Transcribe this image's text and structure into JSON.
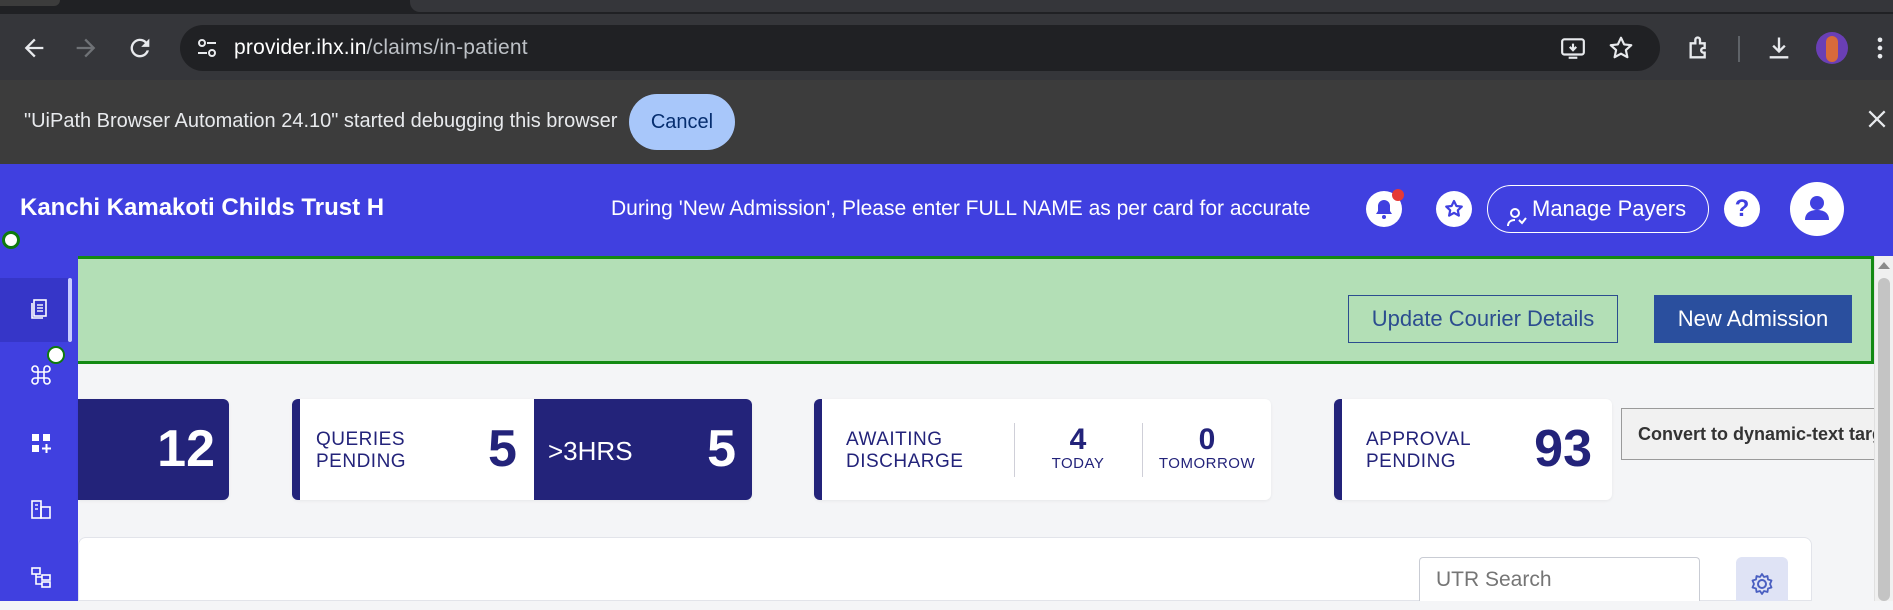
{
  "browser": {
    "url_host": "provider.ihx.in",
    "url_path": "/claims/in-patient"
  },
  "debug_bar": {
    "message": "\"UiPath Browser Automation 24.10\" started debugging this browser",
    "cancel_label": "Cancel"
  },
  "header": {
    "title": "Kanchi Kamakoti Childs Trust H",
    "marquee": "During 'New Admission', Please enter FULL NAME as per card for accurate",
    "manage_payers_label": "Manage Payers",
    "help_label": "?"
  },
  "banner": {
    "update_courier_label": "Update Courier Details",
    "new_admission_label": "New Admission"
  },
  "stats": {
    "first_value": "12",
    "queries": {
      "label_line1": "QUERIES",
      "label_line2": "PENDING",
      "value": "5",
      "over_label": ">3HRS",
      "over_value": "5"
    },
    "awaiting": {
      "label_line1": "AWAITING",
      "label_line2": "DISCHARGE",
      "today_value": "4",
      "today_label": "TODAY",
      "tomorrow_value": "0",
      "tomorrow_label": "TOMORROW"
    },
    "approval": {
      "label_line1": "APPROVAL",
      "label_line2": "PENDING",
      "value": "93"
    }
  },
  "tooltip": {
    "text": "Convert to dynamic-text targe"
  },
  "search": {
    "placeholder": "UTR Search"
  },
  "colors": {
    "header_bg": "#4040e0",
    "card_dark": "#23237a",
    "banner_bg": "#b3dfb6",
    "primary_button": "#2a4f9e",
    "notification_dot": "#e53935"
  },
  "icons": {
    "toolbar": [
      "back-icon",
      "forward-icon",
      "reload-icon",
      "site-info-icon",
      "install-app-icon",
      "bookmark-star-icon",
      "extensions-icon",
      "downloads-icon",
      "profile-avatar",
      "more-menu-icon"
    ],
    "header": [
      "bell-icon",
      "favorites-star-icon",
      "manage-payers-icon",
      "help-icon",
      "user-avatar-icon"
    ],
    "sidebar": [
      "claims-document-icon",
      "command-icon",
      "widgets-icon",
      "building-icon",
      "hierarchy-icon"
    ]
  }
}
